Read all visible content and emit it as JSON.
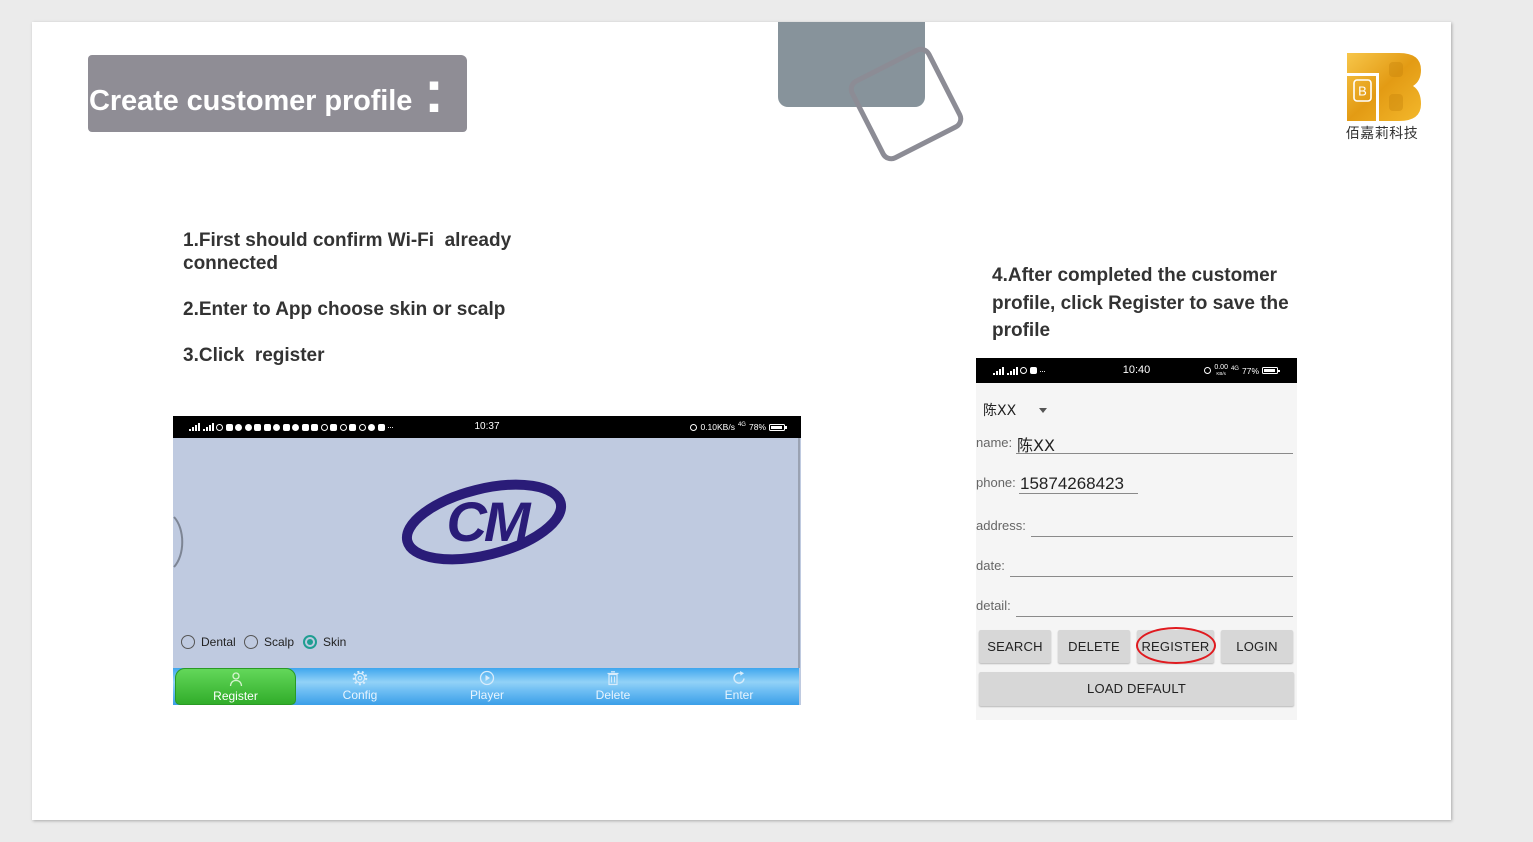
{
  "slide": {
    "title": {
      "text": "Create customer profile",
      "colon": ":"
    },
    "logo": {
      "icon": "company-logo-icon",
      "mark": "B",
      "caption": "佰嘉莉科技",
      "colors": {
        "gold": "#e8a21a"
      }
    },
    "steps_left": [
      "1.First should confirm Wi-Fi  already connected",
      "2.Enter to App choose skin or scalp",
      "3.Click  register"
    ],
    "step_right": "4.After completed the customer profile, click Register to save the profile",
    "colors": {
      "title_bg": "#8f8d95",
      "accent_box": "#87939b",
      "text": "#333333"
    }
  },
  "left_phone": {
    "status": {
      "time": "10:37",
      "net_speed": "0.10KB/s",
      "network": "4G",
      "battery": "78%",
      "more": "···"
    },
    "logo": {
      "icon": "cm-logo-icon",
      "text": "CM",
      "color": "#2a1c78"
    },
    "modes": [
      {
        "label": "Dental",
        "selected": false
      },
      {
        "label": "Scalp",
        "selected": false
      },
      {
        "label": "Skin",
        "selected": true
      }
    ],
    "nav": [
      {
        "label": "Register",
        "icon": "person-icon",
        "active": true
      },
      {
        "label": "Config",
        "icon": "gear-icon",
        "active": false
      },
      {
        "label": "Player",
        "icon": "play-icon",
        "active": false
      },
      {
        "label": "Delete",
        "icon": "trash-icon",
        "active": false
      },
      {
        "label": "Enter",
        "icon": "refresh-icon",
        "active": false
      }
    ],
    "colors": {
      "background": "#bfcae0",
      "nav_active": "#3fbf37",
      "nav_bar": "#4aaaf0",
      "radio_selected": "#1f9e92"
    }
  },
  "right_phone": {
    "status": {
      "time": "10:40",
      "net_speed": "0.00",
      "net_unit": "KB/s",
      "network": "4G",
      "battery": "77%",
      "more": "···"
    },
    "customer_select": {
      "selected": "陈XX"
    },
    "fields": [
      {
        "label": "name:",
        "value": "陈XX"
      },
      {
        "label": "phone:",
        "value": "15874268423"
      },
      {
        "label": "address:",
        "value": ""
      },
      {
        "label": "date:",
        "value": ""
      },
      {
        "label": "detail:",
        "value": ""
      }
    ],
    "buttons": [
      "SEARCH",
      "DELETE",
      "REGISTER",
      "LOGIN"
    ],
    "load_default": "LOAD DEFAULT",
    "colors": {
      "button_bg": "#d7d7d7",
      "highlight": "#e01a1f"
    }
  }
}
